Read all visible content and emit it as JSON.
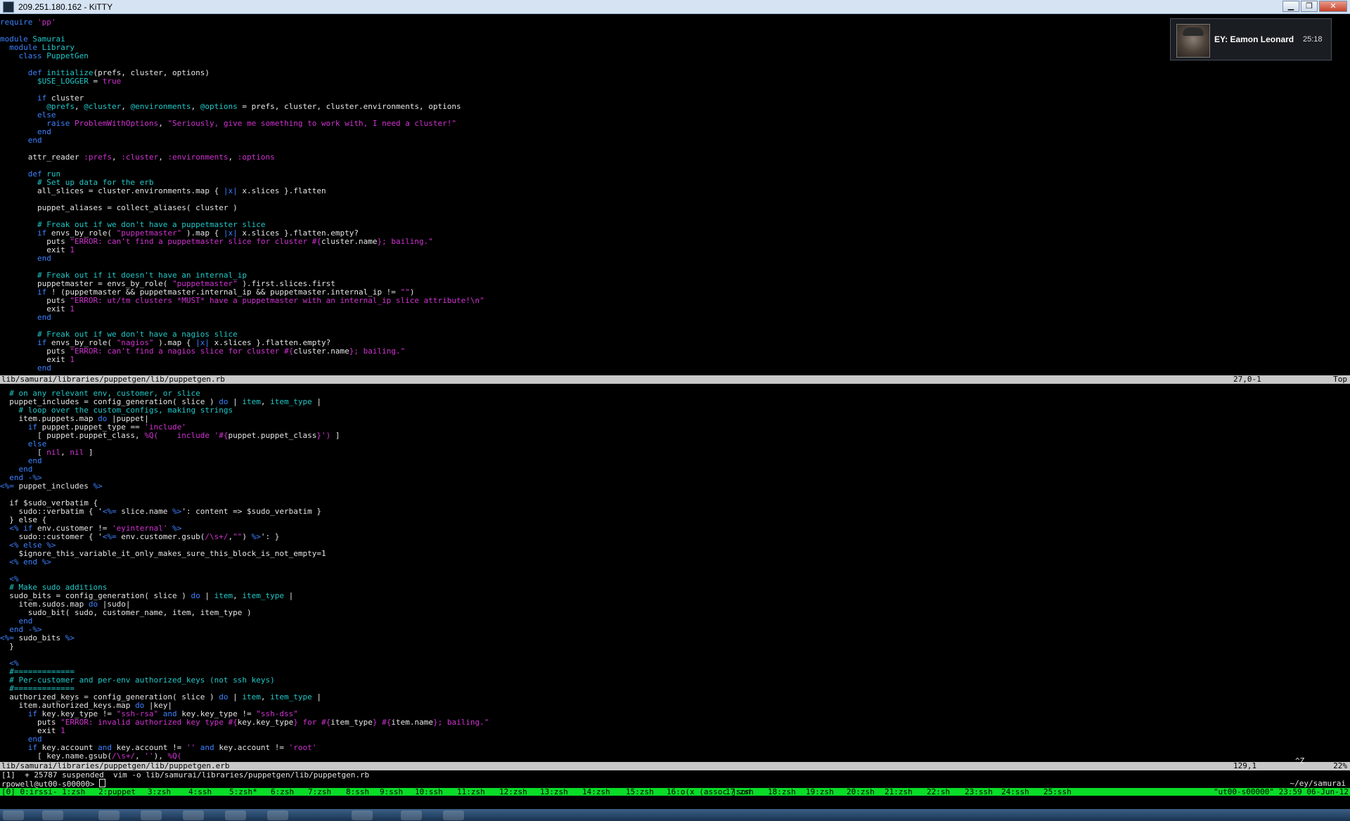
{
  "window": {
    "title": "209.251.180.162 - KiTTY",
    "minimize_glyph": "▁",
    "restore_glyph": "❐",
    "close_glyph": "✕"
  },
  "notification": {
    "name": "EY: Eamon Leonard",
    "time": "25:18"
  },
  "colors": {
    "background": "#000000",
    "plain": "#e5e5e5",
    "keyword": "#3c82ff",
    "cyan": "#20c8c8",
    "magenta": "#d032d0",
    "yellow": "#e8e850",
    "statusbar": "#c8c8c8",
    "tmux_bar": "#0adc28"
  },
  "pane1": {
    "lines": [
      [
        [
          "kw",
          "require "
        ],
        [
          "str",
          "'pp'"
        ]
      ],
      [],
      [
        [
          "kw",
          "module "
        ],
        [
          "type",
          "Samurai"
        ]
      ],
      [
        [
          "kw",
          "  module "
        ],
        [
          "type",
          "Library"
        ]
      ],
      [
        [
          "kw",
          "    class "
        ],
        [
          "type",
          "PuppetGen"
        ]
      ],
      [],
      [
        [
          "kw",
          "      def "
        ],
        [
          "type",
          "initialize"
        ],
        [
          "plain",
          "(prefs, cluster, options)"
        ]
      ],
      [
        [
          "ivar",
          "        $USE_LOGGER"
        ],
        [
          "plain",
          " = "
        ],
        [
          "str",
          "true"
        ]
      ],
      [],
      [
        [
          "kw",
          "        if "
        ],
        [
          "plain",
          "cluster"
        ]
      ],
      [
        [
          "ivar",
          "          @prefs"
        ],
        [
          "plain",
          ", "
        ],
        [
          "ivar",
          "@cluster"
        ],
        [
          "plain",
          ", "
        ],
        [
          "ivar",
          "@environments"
        ],
        [
          "plain",
          ", "
        ],
        [
          "ivar",
          "@options"
        ],
        [
          "plain",
          " = prefs, cluster, cluster.environments, options"
        ]
      ],
      [
        [
          "kw",
          "        else"
        ]
      ],
      [
        [
          "kw",
          "          raise "
        ],
        [
          "const",
          "ProblemWithOptions"
        ],
        [
          "plain",
          ", "
        ],
        [
          "str",
          "\"Seriously, give me something to work with, I need a cluster!\""
        ]
      ],
      [
        [
          "kw",
          "        end"
        ]
      ],
      [
        [
          "kw",
          "      end"
        ]
      ],
      [],
      [
        [
          "plain",
          "      attr_reader "
        ],
        [
          "sym",
          ":prefs"
        ],
        [
          "plain",
          ", "
        ],
        [
          "sym",
          ":cluster"
        ],
        [
          "plain",
          ", "
        ],
        [
          "sym",
          ":environments"
        ],
        [
          "plain",
          ", "
        ],
        [
          "sym",
          ":options"
        ]
      ],
      [],
      [
        [
          "kw",
          "      def "
        ],
        [
          "type",
          "run"
        ]
      ],
      [
        [
          "comment",
          "        # Set up data for the erb"
        ]
      ],
      [
        [
          "plain",
          "        all_slices = cluster.environments.map { "
        ],
        [
          "kw",
          "|x|"
        ],
        [
          "plain",
          " x.slices }.flatten"
        ]
      ],
      [],
      [
        [
          "plain",
          "        puppet_aliases = collect_aliases( cluster )"
        ]
      ],
      [],
      [
        [
          "comment",
          "        # Freak out if we don't have a puppetmaster slice"
        ]
      ],
      [
        [
          "kw",
          "        if "
        ],
        [
          "plain",
          "envs_by_role( "
        ],
        [
          "str",
          "\"puppetmaster\""
        ],
        [
          "plain",
          " ).map { "
        ],
        [
          "kw",
          "|x|"
        ],
        [
          "plain",
          " x.slices }.flatten.empty?"
        ]
      ],
      [
        [
          "plain",
          "          puts "
        ],
        [
          "str",
          "\"ERROR: can't find a puppetmaster slice for cluster #{"
        ],
        [
          "plain",
          "cluster.name"
        ],
        [
          "str",
          "}; bailing.\""
        ]
      ],
      [
        [
          "plain",
          "          exit "
        ],
        [
          "str",
          "1"
        ]
      ],
      [
        [
          "kw",
          "        end"
        ]
      ],
      [],
      [
        [
          "comment",
          "        # Freak out if it doesn't have an internal_ip"
        ]
      ],
      [
        [
          "plain",
          "        puppetmaster = envs_by_role( "
        ],
        [
          "str",
          "\"puppetmaster\""
        ],
        [
          "plain",
          " ).first.slices.first"
        ]
      ],
      [
        [
          "kw",
          "        if "
        ],
        [
          "plain",
          "! (puppetmaster && puppetmaster.internal_ip && puppetmaster.internal_ip != "
        ],
        [
          "str",
          "\"\""
        ],
        [
          "plain",
          ")"
        ]
      ],
      [
        [
          "plain",
          "          puts "
        ],
        [
          "str",
          "\"ERROR: ut/tm clusters *MUST* have a puppetmaster with an internal_ip slice attribute!\\n\""
        ]
      ],
      [
        [
          "plain",
          "          exit "
        ],
        [
          "str",
          "1"
        ]
      ],
      [
        [
          "kw",
          "        end"
        ]
      ],
      [],
      [
        [
          "comment",
          "        # Freak out if we don't have a nagios slice"
        ]
      ],
      [
        [
          "kw",
          "        if "
        ],
        [
          "plain",
          "envs_by_role( "
        ],
        [
          "str",
          "\"nagios\""
        ],
        [
          "plain",
          " ).map { "
        ],
        [
          "kw",
          "|x|"
        ],
        [
          "plain",
          " x.slices }.flatten.empty?"
        ]
      ],
      [
        [
          "plain",
          "          puts "
        ],
        [
          "str",
          "\"ERROR: can't find a nagios slice for cluster #{"
        ],
        [
          "plain",
          "cluster.name"
        ],
        [
          "str",
          "}; bailing.\""
        ]
      ],
      [
        [
          "plain",
          "          exit "
        ],
        [
          "str",
          "1"
        ]
      ],
      [
        [
          "kw",
          "        end"
        ]
      ]
    ]
  },
  "status1": {
    "file": "lib/samurai/libraries/puppetgen/lib/puppetgen.rb",
    "position": "27,0-1",
    "scroll": "Top"
  },
  "pane2": {
    "lines": [
      [
        [
          "comment",
          "  # on any relevant env, customer, or slice"
        ]
      ],
      [
        [
          "plain",
          "  puppet_includes = config_generation( slice ) "
        ],
        [
          "kw",
          "do"
        ],
        [
          "plain",
          " | "
        ],
        [
          "type",
          "item"
        ],
        [
          "plain",
          ", "
        ],
        [
          "type",
          "item_type"
        ],
        [
          "plain",
          " |"
        ]
      ],
      [
        [
          "comment",
          "    # loop over the custom_configs, making strings"
        ]
      ],
      [
        [
          "plain",
          "    item.puppets.map "
        ],
        [
          "kw",
          "do"
        ],
        [
          "plain",
          " |puppet|"
        ]
      ],
      [
        [
          "kw",
          "      if "
        ],
        [
          "plain",
          "puppet.puppet_type == "
        ],
        [
          "str",
          "'include'"
        ]
      ],
      [
        [
          "plain",
          "        [ puppet.puppet_class, "
        ],
        [
          "str",
          "%Q(    include '#{"
        ],
        [
          "plain",
          "puppet.puppet_class"
        ],
        [
          "str",
          "}')"
        ],
        [
          "plain",
          " ]"
        ]
      ],
      [
        [
          "kw",
          "      else"
        ]
      ],
      [
        [
          "plain",
          "        [ "
        ],
        [
          "str",
          "nil"
        ],
        [
          "plain",
          ", "
        ],
        [
          "str",
          "nil"
        ],
        [
          "plain",
          " ]"
        ]
      ],
      [
        [
          "kw",
          "      end"
        ]
      ],
      [
        [
          "kw",
          "    end"
        ]
      ],
      [
        [
          "kw",
          "  end "
        ],
        [
          "erb",
          "-%>"
        ]
      ],
      [
        [
          "erb",
          "<%= "
        ],
        [
          "plain",
          "puppet_includes "
        ],
        [
          "erb",
          "%>"
        ]
      ],
      [],
      [
        [
          "plain",
          "  if $sudo_verbatim {"
        ]
      ],
      [
        [
          "plain",
          "    sudo::verbatim { '"
        ],
        [
          "erb",
          "<%= "
        ],
        [
          "plain",
          "slice.name "
        ],
        [
          "erb",
          "%>"
        ],
        [
          "plain",
          "': content => $sudo_verbatim }"
        ]
      ],
      [
        [
          "plain",
          "  } else {"
        ]
      ],
      [
        [
          "erb",
          "  <% "
        ],
        [
          "kw",
          "if "
        ],
        [
          "plain",
          "env.customer != "
        ],
        [
          "str",
          "'eyinternal'"
        ],
        [
          "erb",
          " %>"
        ]
      ],
      [
        [
          "plain",
          "    sudo::customer { '"
        ],
        [
          "erb",
          "<%= "
        ],
        [
          "plain",
          "env.customer.gsub("
        ],
        [
          "str",
          "/\\s+/"
        ],
        [
          "plain",
          ","
        ],
        [
          "str",
          "\"\""
        ],
        [
          "plain",
          ") "
        ],
        [
          "erb",
          "%>"
        ],
        [
          "plain",
          "': }"
        ]
      ],
      [
        [
          "erb",
          "  <% "
        ],
        [
          "kw",
          "else "
        ],
        [
          "erb",
          "%>"
        ]
      ],
      [
        [
          "plain",
          "    $ignore_this_variable_it_only_makes_sure_this_block_is_not_empty=1"
        ]
      ],
      [
        [
          "erb",
          "  <% "
        ],
        [
          "kw",
          "end "
        ],
        [
          "erb",
          "%>"
        ]
      ],
      [],
      [
        [
          "erb",
          "  <%"
        ]
      ],
      [
        [
          "comment",
          "  # Make sudo additions"
        ]
      ],
      [
        [
          "plain",
          "  sudo_bits = config_generation( slice ) "
        ],
        [
          "kw",
          "do"
        ],
        [
          "plain",
          " | "
        ],
        [
          "type",
          "item"
        ],
        [
          "plain",
          ", "
        ],
        [
          "type",
          "item_type"
        ],
        [
          "plain",
          " |"
        ]
      ],
      [
        [
          "plain",
          "    item.sudos.map "
        ],
        [
          "kw",
          "do"
        ],
        [
          "plain",
          " |sudo|"
        ]
      ],
      [
        [
          "plain",
          "      sudo_bit( sudo, customer_name, item, item_type )"
        ]
      ],
      [
        [
          "kw",
          "    end"
        ]
      ],
      [
        [
          "kw",
          "  end "
        ],
        [
          "erb",
          "-%>"
        ]
      ],
      [
        [
          "erb",
          "<%= "
        ],
        [
          "plain",
          "sudo_bits "
        ],
        [
          "erb",
          "%>"
        ]
      ],
      [
        [
          "plain",
          "  }"
        ]
      ],
      [],
      [
        [
          "erb",
          "  <%"
        ]
      ],
      [
        [
          "comment",
          "  #============="
        ]
      ],
      [
        [
          "comment",
          "  # Per-customer and per-env authorized_keys (not ssh keys)"
        ]
      ],
      [
        [
          "comment",
          "  #============="
        ]
      ],
      [
        [
          "plain",
          "  authorized_keys = config_generation( slice ) "
        ],
        [
          "kw",
          "do"
        ],
        [
          "plain",
          " | "
        ],
        [
          "type",
          "item"
        ],
        [
          "plain",
          ", "
        ],
        [
          "type",
          "item_type"
        ],
        [
          "plain",
          " |"
        ]
      ],
      [
        [
          "plain",
          "    item.authorized_keys.map "
        ],
        [
          "kw",
          "do"
        ],
        [
          "plain",
          " |key|"
        ]
      ],
      [
        [
          "kw",
          "      if "
        ],
        [
          "plain",
          "key.key_type != "
        ],
        [
          "str",
          "\"ssh-rsa\""
        ],
        [
          "kw",
          " and "
        ],
        [
          "plain",
          "key.key_type != "
        ],
        [
          "str",
          "\"ssh-dss\""
        ]
      ],
      [
        [
          "plain",
          "        puts "
        ],
        [
          "str",
          "\"ERROR: invalid authorized key type #{"
        ],
        [
          "plain",
          "key.key_type"
        ],
        [
          "str",
          "} for #{"
        ],
        [
          "plain",
          "item_type"
        ],
        [
          "str",
          "} #{"
        ],
        [
          "plain",
          "item.name"
        ],
        [
          "str",
          "}; bailing.\""
        ]
      ],
      [
        [
          "plain",
          "        exit "
        ],
        [
          "str",
          "1"
        ]
      ],
      [
        [
          "kw",
          "      end"
        ]
      ],
      [
        [
          "kw",
          "      if "
        ],
        [
          "plain",
          "key.account "
        ],
        [
          "kw",
          "and "
        ],
        [
          "plain",
          "key.account != "
        ],
        [
          "str",
          "''"
        ],
        [
          "kw",
          " and "
        ],
        [
          "plain",
          "key.account != "
        ],
        [
          "str",
          "'root'"
        ]
      ],
      [
        [
          "plain",
          "        [ key.name.gsub("
        ],
        [
          "str",
          "/\\s+/"
        ],
        [
          "plain",
          ", "
        ],
        [
          "str",
          "''"
        ],
        [
          "plain",
          "), "
        ],
        [
          "str",
          "%Q("
        ]
      ]
    ]
  },
  "status2": {
    "file": "lib/samurai/libraries/puppetgen/lib/puppetgen.erb",
    "position": "129,1",
    "scroll": "22%"
  },
  "shell": {
    "caret_z": "^Z",
    "job_line": "[1]  + 25787 suspended  vim -o lib/samurai/libraries/puppetgen/lib/puppetgen.rb",
    "prompt": "rpowell@ut00-s00000> ",
    "cwd": "~/ey/samurai"
  },
  "tmux": {
    "windows": [
      "[0] 0:irssi- 1:zsh",
      "2:puppet",
      "3:zsh",
      "4:ssh",
      "5:zsh*",
      "6:zsh",
      "7:zsh",
      "8:ssh",
      "9:ssh",
      "10:ssh",
      "11:zsh",
      "12:zsh",
      "13:zsh",
      "14:zsh",
      "15:zsh",
      "16:o(x (assoc json",
      "17:zsh",
      "18:zsh",
      "19:zsh",
      "20:zsh",
      "21:zsh",
      "22:sh",
      "23:ssh",
      "24:ssh",
      "25:ssh"
    ],
    "clock": "\"ut00-s00000\" 23:59 06-Jun-12"
  }
}
